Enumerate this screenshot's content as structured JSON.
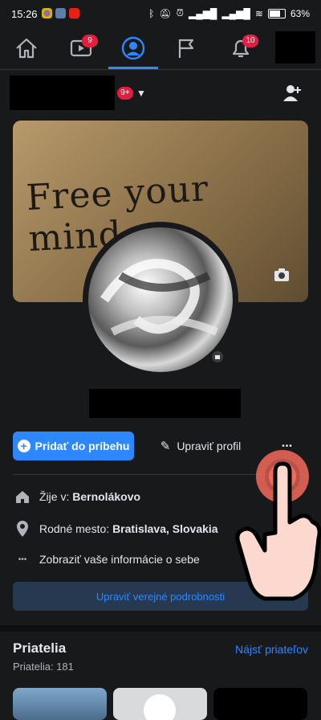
{
  "statusbar": {
    "time": "15:26",
    "battery": "63"
  },
  "nav": {
    "video_badge": "9",
    "notifications_badge": "10"
  },
  "profile": {
    "switcher_badge": "9+",
    "cover_text": "Free your mind",
    "add_story_label": "Pridať do príbehu",
    "edit_profile_label": "Upraviť profil",
    "more_label": "•••"
  },
  "info": {
    "lives_prefix": "Žije v: ",
    "lives_value": "Bernolákovo",
    "hometown_prefix": "Rodné mesto: ",
    "hometown_value": "Bratislava, Slovakia",
    "about_link": "Zobraziť vaše informácie o sebe",
    "edit_public_details": "Upraviť verejné podrobnosti"
  },
  "friends": {
    "title": "Priatelia",
    "count": "Priatelia: 181",
    "find_link": "Nájsť priateľov"
  },
  "colors": {
    "accent": "#2d88ff",
    "badge": "#e41e3f",
    "background": "#18191a"
  }
}
